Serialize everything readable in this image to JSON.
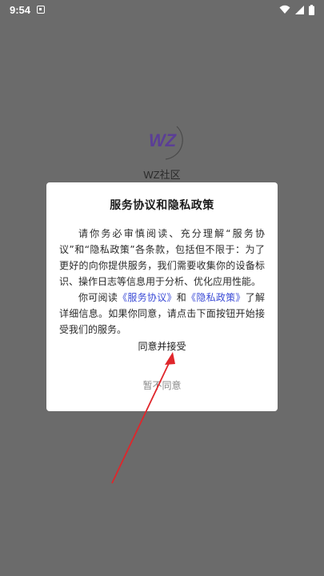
{
  "status_bar": {
    "time": "9:54",
    "notification_icon": "android-notification-icon",
    "wifi_icon": "wifi-icon",
    "signal_icon": "cell-signal-icon",
    "battery_icon": "battery-icon"
  },
  "app": {
    "logo_text": "WZ",
    "name": "WZ社区"
  },
  "dialog": {
    "title": "服务协议和隐私政策",
    "paragraph1": "请你务必审慎阅读、充分理解“服务协议”和“隐私政策”各条款，包括但不限于：为了更好的向你提供服务，我们需要收集你的设备标识、操作日志等信息用于分析、优化应用性能。",
    "paragraph2_prefix": "你可阅读",
    "service_link": "《服务协议》",
    "and_text": "和",
    "privacy_link": "《隐私政策》",
    "paragraph2_suffix": "了解详细信息。如果你同意，请点击下面按钮开始接受我们的服务。",
    "agree_label": "同意并接受",
    "decline_label": "暂不同意"
  },
  "colors": {
    "overlay": "#6b6b6b",
    "link": "#3b4bd6",
    "logo": "#5b3e96",
    "annotation_arrow": "#e0262b"
  }
}
